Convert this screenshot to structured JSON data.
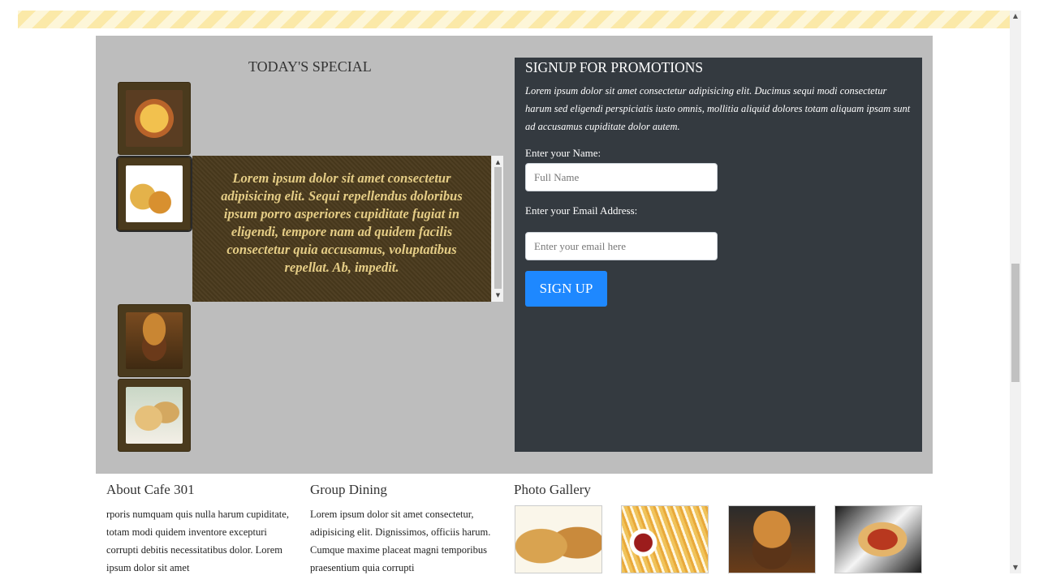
{
  "special": {
    "title": "TODAY'S SPECIAL",
    "description": "Lorem ipsum dolor sit amet consectetur adipisicing elit. Sequi repellendus doloribus ipsum porro asperiores cupiditate fugiat in eligendi, tempore nam ad quidem facilis consectetur quia accusamus, voluptatibus repellat. Ab, impedit.",
    "items": [
      {
        "icon": "pizza-icon"
      },
      {
        "icon": "burger-fries-combo-icon"
      },
      {
        "icon": "burger-icon"
      },
      {
        "icon": "wraps-icon"
      }
    ],
    "colors": {
      "panel": "#bdbdbd",
      "thumb_bg": "#4a3a1d",
      "desc_text": "#e5cd86"
    }
  },
  "signup": {
    "title": "SIGNUP FOR PROMOTIONS",
    "description": "Lorem ipsum dolor sit amet consectetur adipisicing elit. Ducimus sequi modi consectetur harum sed eligendi perspiciatis iusto omnis, mollitia aliquid dolores totam aliquam ipsam sunt ad accusamus cupiditate dolor autem.",
    "name_label": "Enter your Name:",
    "name_placeholder": "Full Name",
    "name_value": "",
    "email_label": "Enter your Email Address:",
    "email_placeholder": "Enter your email here",
    "email_value": "",
    "button_label": "SIGN UP",
    "colors": {
      "panel": "#343a40",
      "button": "#1e88ff"
    }
  },
  "footer": {
    "about": {
      "heading": "About Cafe 301",
      "text": "rporis numquam quis nulla harum cupiditate, totam modi quidem inventore excepturi corrupti debitis necessitatibus dolor. Lorem ipsum dolor sit amet"
    },
    "group": {
      "heading": "Group Dining",
      "text": "Lorem ipsum dolor sit amet consectetur, adipisicing elit. Dignissimos, officiis harum. Cumque maxime placeat magni temporibus praesentium quia corrupti"
    },
    "gallery": {
      "heading": "Photo Gallery",
      "images": [
        "wraps-photo",
        "fries-photo",
        "burger-photo",
        "hotdog-photo"
      ]
    }
  }
}
